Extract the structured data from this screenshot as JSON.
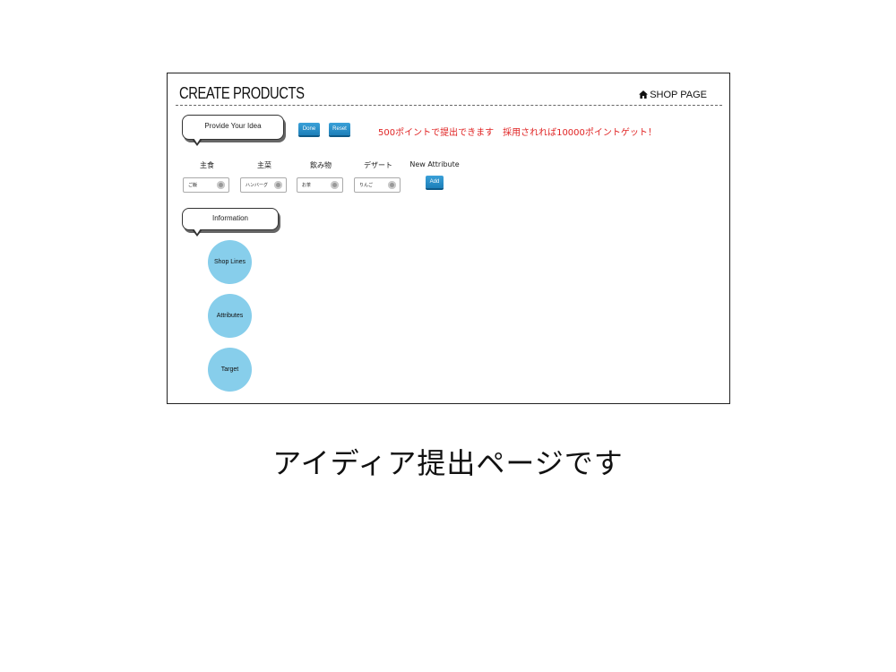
{
  "header": {
    "title": "CREATE PRODUCTS",
    "shop_link": "SHOP PAGE",
    "shop_icon": "home-icon"
  },
  "idea_section": {
    "bubble_label": "Provide Your Idea",
    "done_label": "Done",
    "reset_label": "Reset",
    "notice": "500ポイントで提出できます　採用されれば10000ポイントゲット！",
    "notice_color": "#e02424"
  },
  "attributes": [
    {
      "label": "主食",
      "value": "ご飯"
    },
    {
      "label": "主菜",
      "value": "ハンバーグ"
    },
    {
      "label": "飲み物",
      "value": "お茶"
    },
    {
      "label": "デザート",
      "value": "りんご"
    }
  ],
  "new_attribute": {
    "label": "New Attribute",
    "add_label": "Add"
  },
  "info_section": {
    "bubble_label": "Information",
    "circles": [
      "Shop Lines",
      "Attributes",
      "Target"
    ],
    "circle_color": "#87ceeb"
  },
  "caption": "アイディア提出ページです"
}
